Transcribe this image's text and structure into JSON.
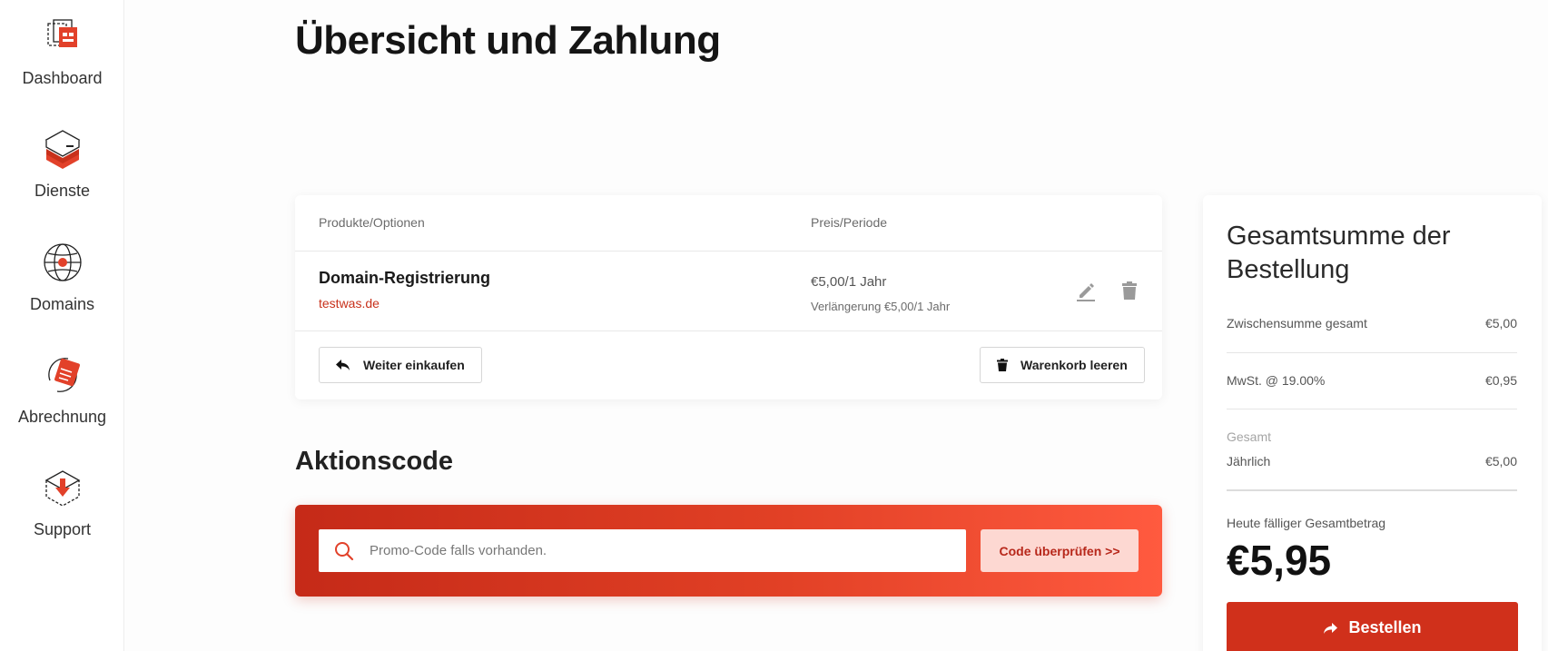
{
  "sidebar": {
    "items": [
      {
        "label": "Dashboard",
        "icon": "dashboard-icon"
      },
      {
        "label": "Dienste",
        "icon": "services-icon"
      },
      {
        "label": "Domains",
        "icon": "globe-icon"
      },
      {
        "label": "Abrechnung",
        "icon": "billing-icon"
      },
      {
        "label": "Support",
        "icon": "support-icon"
      }
    ]
  },
  "page": {
    "title": "Übersicht und Zahlung"
  },
  "cart": {
    "headers": {
      "product": "Produkte/Optionen",
      "price": "Preis/Periode"
    },
    "item": {
      "name": "Domain-Registrierung",
      "domain": "testwas.de",
      "price": "€5,00/1 Jahr",
      "renewal": "Verlängerung €5,00/1 Jahr"
    },
    "continue_label": "Weiter einkaufen",
    "empty_label": "Warenkorb leeren"
  },
  "promo": {
    "title": "Aktionscode",
    "placeholder": "Promo-Code falls vorhanden.",
    "button_label": "Code überprüfen >>"
  },
  "summary": {
    "title": "Gesamtsumme der Bestellung",
    "subtotal_label": "Zwischensumme gesamt",
    "subtotal_value": "€5,00",
    "tax_label": "MwSt. @ 19.00%",
    "tax_value": "€0,95",
    "total_heading": "Gesamt",
    "recurring_label": "Jährlich",
    "recurring_value": "€5,00",
    "due_label": "Heute fälliger Gesamtbetrag",
    "due_value": "€5,95",
    "order_label": "Bestellen"
  },
  "colors": {
    "accent": "#d0301b",
    "accent_light": "#fdd8d2",
    "link": "#c8311b"
  }
}
